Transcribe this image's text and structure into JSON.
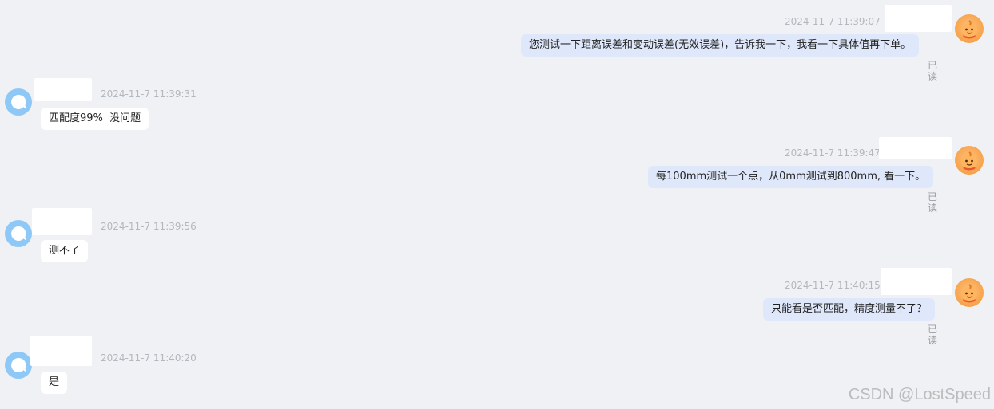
{
  "messages": [
    {
      "side": "right",
      "time": "2024-11-7 11:39:07",
      "text": "您测试一下距离误差和变动误差(无效误差)，告诉我一下，我看一下具体值再下单。",
      "status": "已读"
    },
    {
      "side": "left",
      "time": "2024-11-7 11:39:31",
      "text": "匹配度99%  没问题"
    },
    {
      "side": "right",
      "time": "2024-11-7 11:39:47",
      "text": "每100mm测试一个点，从0mm测试到800mm, 看一下。",
      "status": "已读"
    },
    {
      "side": "left",
      "time": "2024-11-7 11:39:56",
      "text": "测不了"
    },
    {
      "side": "right",
      "time": "2024-11-7 11:40:15",
      "text": "只能看是否匹配，精度测量不了？",
      "status": "已读"
    },
    {
      "side": "left",
      "time": "2024-11-7 11:40:20",
      "text": "是"
    }
  ],
  "watermark": "CSDN @LostSpeed",
  "colors": {
    "background": "#f0f1f5",
    "right_bubble": "#dfe8fb",
    "left_bubble": "#ffffff",
    "left_avatar": "#8ec8f6",
    "right_avatar": "#f7a24b"
  }
}
